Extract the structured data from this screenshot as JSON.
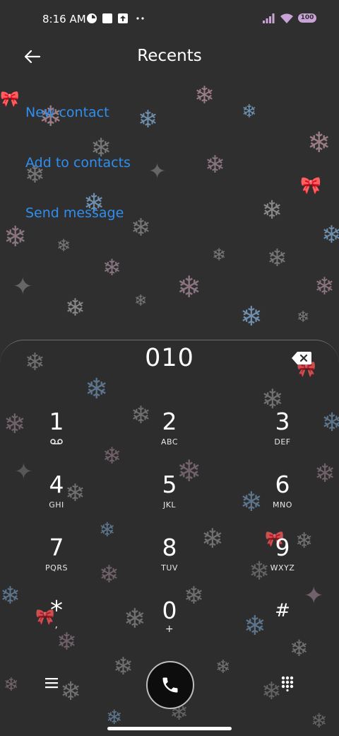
{
  "status": {
    "time": "8:16 AM",
    "battery": "100",
    "icons": [
      "vpn-icon",
      "square-icon",
      "upload-icon",
      "more-dots-icon",
      "signal-icon",
      "wifi-icon",
      "battery-icon"
    ]
  },
  "header": {
    "title": "Recents",
    "back_icon": "back-arrow-icon"
  },
  "actions": [
    "New contact",
    "Add to contacts",
    "Send message"
  ],
  "dialer": {
    "number": "010",
    "keys": [
      {
        "digit": "1",
        "letters": ""
      },
      {
        "digit": "2",
        "letters": "ABC"
      },
      {
        "digit": "3",
        "letters": "DEF"
      },
      {
        "digit": "4",
        "letters": "GHI"
      },
      {
        "digit": "5",
        "letters": "JKL"
      },
      {
        "digit": "6",
        "letters": "MNO"
      },
      {
        "digit": "7",
        "letters": "PQRS"
      },
      {
        "digit": "8",
        "letters": "TUV"
      },
      {
        "digit": "9",
        "letters": "WXYZ"
      },
      {
        "digit": "*",
        "letters": ","
      },
      {
        "digit": "0",
        "letters": "+"
      },
      {
        "digit": "#",
        "letters": ""
      }
    ]
  },
  "colors": {
    "accent": "#2f8ff0",
    "background": "#2f2f2f"
  }
}
